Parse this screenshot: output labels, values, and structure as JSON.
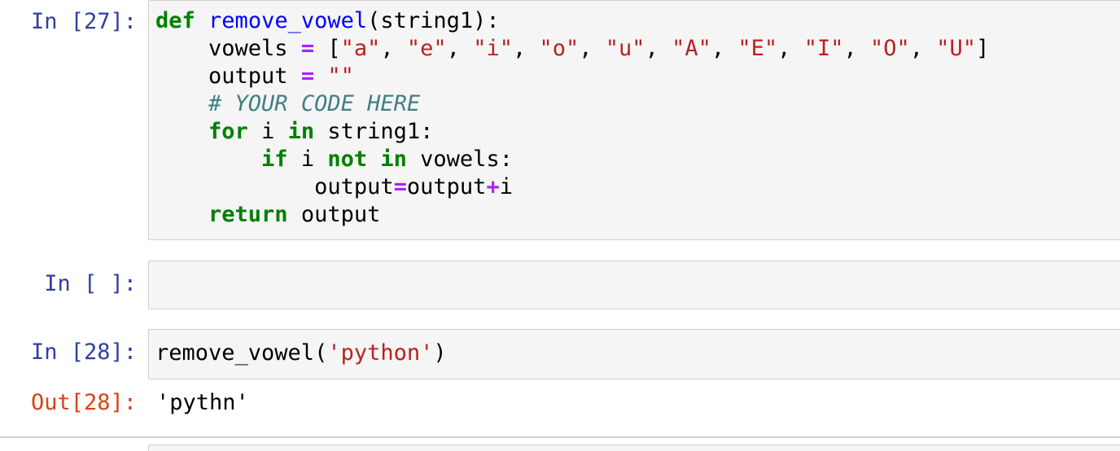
{
  "cells": [
    {
      "prompt": "In [27]:",
      "code": {
        "line1": {
          "kw": "def",
          "fn": "remove_vowel",
          "rest": "(string1):"
        },
        "line2": {
          "indent": "    ",
          "var": "vowels ",
          "op": "=",
          "open": " [",
          "items": [
            "\"a\"",
            "\"e\"",
            "\"i\"",
            "\"o\"",
            "\"u\"",
            "\"A\"",
            "\"E\"",
            "\"I\"",
            "\"O\"",
            "\"U\""
          ],
          "sep": ", ",
          "close": "]"
        },
        "line3": {
          "indent": "    ",
          "var": "output ",
          "op": "=",
          "str": "\"\""
        },
        "line4": {
          "indent": "    ",
          "comment": "# YOUR CODE HERE"
        },
        "line5": {
          "indent": "    ",
          "kw1": "for",
          "mid": " i ",
          "kw2": "in",
          "rest": " string1:"
        },
        "line6": {
          "indent": "        ",
          "kw1": "if",
          "mid": " i ",
          "kw2": "not",
          "kw3": "in",
          "rest": " vowels:"
        },
        "line7": {
          "indent": "            ",
          "a": "output",
          "op1": "=",
          "b": "output",
          "op2": "+",
          "c": "i"
        },
        "line8": {
          "indent": "    ",
          "kw": "return",
          "rest": " output"
        }
      }
    },
    {
      "prompt": "In [ ]:"
    },
    {
      "prompt": "In [28]:",
      "code": {
        "fn": "remove_vowel",
        "open": "(",
        "str": "'python'",
        "close": ")"
      },
      "out_prompt": "Out[28]:",
      "output": "'pythn'"
    }
  ],
  "colors": {
    "in_prompt": "#303f9f",
    "out_prompt": "#d84315",
    "keyword": "#008000",
    "function": "#0000ff",
    "string": "#ba2121",
    "operator": "#aa22ff",
    "comment": "#408080",
    "cell_bg": "#f5f5f5",
    "cell_border": "#cfcfcf"
  }
}
